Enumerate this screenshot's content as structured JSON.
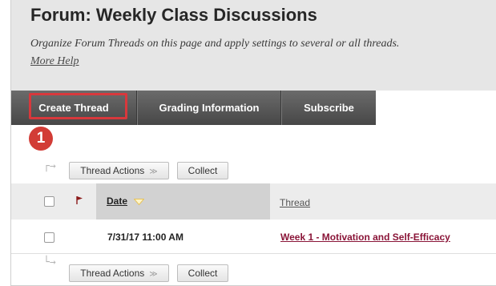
{
  "page": {
    "title": "Forum: Weekly Class Discussions",
    "description": "Organize Forum Threads on this page and apply settings to several or all threads.",
    "help_link": "More Help"
  },
  "action_bar": {
    "create_thread": "Create Thread",
    "grading_information": "Grading Information",
    "subscribe": "Subscribe"
  },
  "annotation": {
    "step_number": "1",
    "highlight_color": "#d8383c",
    "badge_color": "#d23c36"
  },
  "toolbar_top": {
    "thread_actions": "Thread Actions",
    "collect": "Collect"
  },
  "toolbar_bottom": {
    "thread_actions": "Thread Actions",
    "collect": "Collect"
  },
  "table": {
    "columns": {
      "date": "Date",
      "thread": "Thread"
    },
    "sort": "descending",
    "rows": [
      {
        "date": "7/31/17 11:00 AM",
        "thread": "Week 1 - Motivation and Self-Efficacy"
      }
    ]
  },
  "colors": {
    "header_bg": "#e6e6e6",
    "action_bar": "#555555",
    "thread_link": "#8a1538",
    "flag": "#8b1a1a"
  }
}
